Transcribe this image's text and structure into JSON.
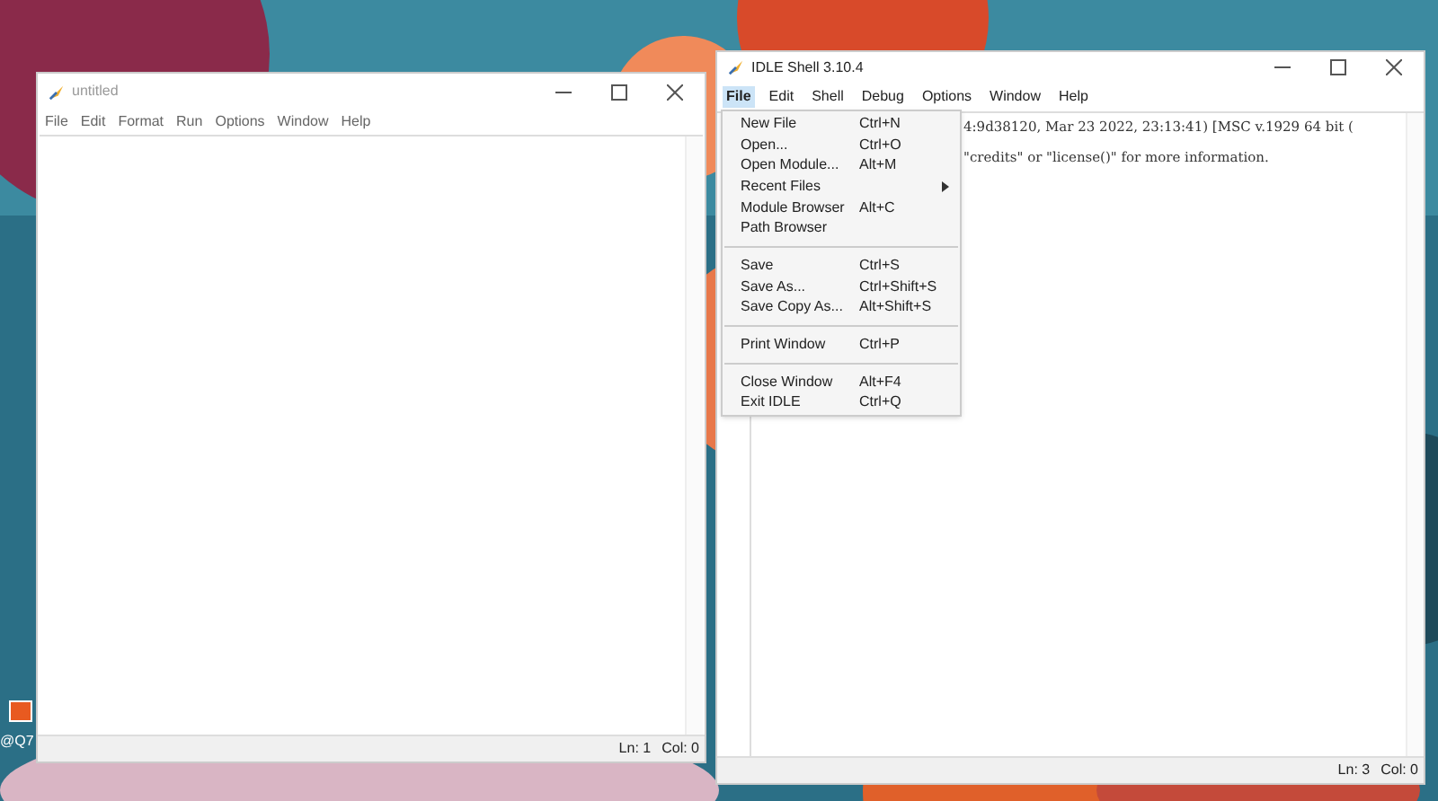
{
  "desktop": {
    "icon_label": "@Q7"
  },
  "editor": {
    "title": "untitled",
    "menu": [
      "File",
      "Edit",
      "Format",
      "Run",
      "Options",
      "Window",
      "Help"
    ],
    "status": [
      "Ln: 1",
      "Col: 0"
    ]
  },
  "shell": {
    "title": "IDLE Shell 3.10.4",
    "menu": [
      {
        "label": "File",
        "selected": true
      },
      {
        "label": "Edit",
        "selected": false
      },
      {
        "label": "Shell",
        "selected": false
      },
      {
        "label": "Debug",
        "selected": false
      },
      {
        "label": "Options",
        "selected": false
      },
      {
        "label": "Window",
        "selected": false
      },
      {
        "label": "Help",
        "selected": false
      }
    ],
    "lines": [
      "4:9d38120, Mar 23 2022, 23:13:41) [MSC v.1929 64 bit (",
      "\"credits\" or \"license()\" for more information."
    ],
    "status": [
      "Ln: 3",
      "Col: 0"
    ]
  },
  "file_menu": [
    {
      "kind": "item",
      "label": "New File",
      "shortcut": "Ctrl+N"
    },
    {
      "kind": "item",
      "label": "Open...",
      "shortcut": "Ctrl+O"
    },
    {
      "kind": "item",
      "label": "Open Module...",
      "shortcut": "Alt+M"
    },
    {
      "kind": "submenu",
      "label": "Recent Files"
    },
    {
      "kind": "item",
      "label": "Module Browser",
      "shortcut": "Alt+C"
    },
    {
      "kind": "item",
      "label": "Path Browser"
    },
    {
      "kind": "separator"
    },
    {
      "kind": "item",
      "label": "Save",
      "shortcut": "Ctrl+S"
    },
    {
      "kind": "item",
      "label": "Save As...",
      "shortcut": "Ctrl+Shift+S"
    },
    {
      "kind": "item",
      "label": "Save Copy As...",
      "shortcut": "Alt+Shift+S"
    },
    {
      "kind": "separator"
    },
    {
      "kind": "item",
      "label": "Print Window",
      "shortcut": "Ctrl+P"
    },
    {
      "kind": "separator"
    },
    {
      "kind": "item",
      "label": "Close Window",
      "shortcut": "Alt+F4"
    },
    {
      "kind": "item",
      "label": "Exit IDLE",
      "shortcut": "Ctrl+Q"
    }
  ]
}
